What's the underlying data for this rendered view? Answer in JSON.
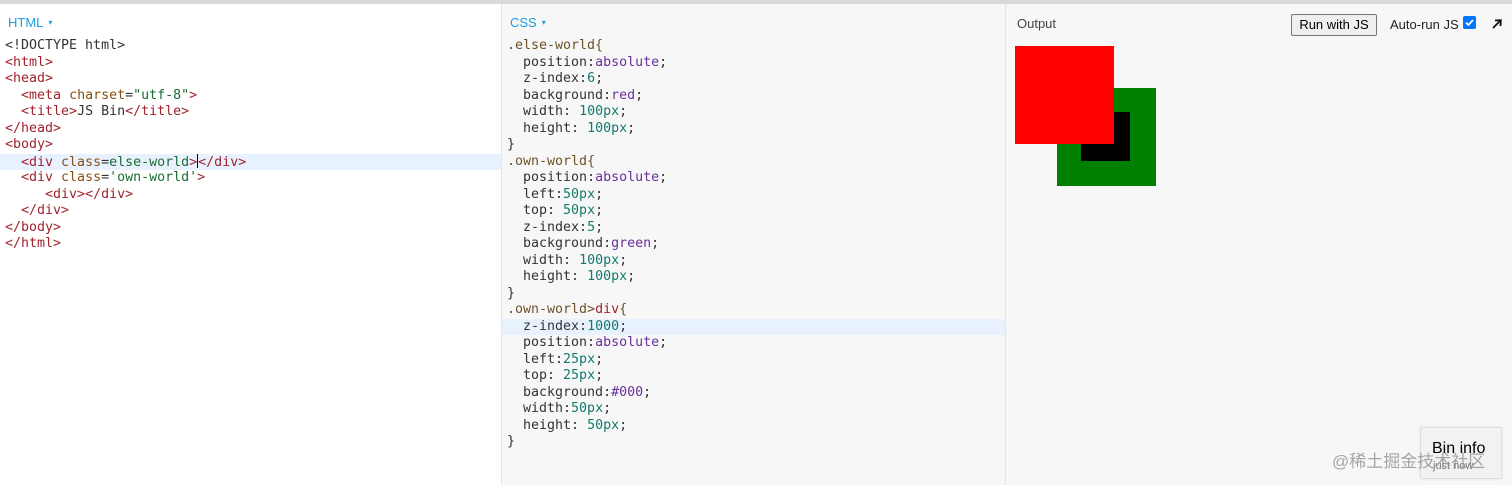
{
  "panes": {
    "html_title": "HTML",
    "css_title": "CSS",
    "output_title": "Output",
    "caret": "▾"
  },
  "html_code": [
    [
      [
        "t-plain",
        "<!DOCTYPE html>"
      ]
    ],
    [
      [
        "t-tag",
        "<html>"
      ]
    ],
    [
      [
        "t-tag",
        "<head>"
      ]
    ],
    [
      [
        "t-plain",
        "  "
      ],
      [
        "t-tag",
        "<meta "
      ],
      [
        "t-attr",
        "charset"
      ],
      [
        "t-plain",
        "="
      ],
      [
        "t-str",
        "\"utf-8\""
      ],
      [
        "t-tag",
        ">"
      ]
    ],
    [
      [
        "t-plain",
        "  "
      ],
      [
        "t-tag",
        "<title>"
      ],
      [
        "t-plain",
        "JS Bin"
      ],
      [
        "t-tag",
        "</title>"
      ]
    ],
    [
      [
        "t-tag",
        "</head>"
      ]
    ],
    [
      [
        "t-tag",
        "<body>"
      ]
    ],
    [
      [
        "t-plain",
        "  "
      ],
      [
        "t-tag",
        "<div "
      ],
      [
        "t-attr",
        "class"
      ],
      [
        "t-plain",
        "="
      ],
      [
        "t-str",
        "else-world"
      ],
      [
        "t-tag",
        ">"
      ],
      [
        "cursor",
        ""
      ],
      [
        "t-tag",
        "</div>"
      ]
    ],
    [
      [
        "t-plain",
        "  "
      ],
      [
        "t-tag",
        "<div "
      ],
      [
        "t-attr",
        "class"
      ],
      [
        "t-plain",
        "="
      ],
      [
        "t-str",
        "'own-world'"
      ],
      [
        "t-tag",
        ">"
      ]
    ],
    [
      [
        "t-plain",
        "     "
      ],
      [
        "t-tag",
        "<div></div>"
      ]
    ],
    [
      [
        "t-plain",
        "  "
      ],
      [
        "t-tag",
        "</div>"
      ]
    ],
    [
      [
        "t-tag",
        "</body>"
      ]
    ],
    [
      [
        "t-tag",
        "</html>"
      ]
    ]
  ],
  "html_active_line": 7,
  "css_code": [
    [
      [
        "t-sel",
        ".else-world{"
      ]
    ],
    [
      [
        "t-prop",
        "  position:"
      ],
      [
        "t-val",
        "absolute"
      ],
      [
        "t-plain",
        ";"
      ]
    ],
    [
      [
        "t-prop",
        "  z-index:"
      ],
      [
        "t-num",
        "6"
      ],
      [
        "t-plain",
        ";"
      ]
    ],
    [
      [
        "t-prop",
        "  background:"
      ],
      [
        "t-val",
        "red"
      ],
      [
        "t-plain",
        ";"
      ]
    ],
    [
      [
        "t-prop",
        "  width: "
      ],
      [
        "t-num",
        "100px"
      ],
      [
        "t-plain",
        ";"
      ]
    ],
    [
      [
        "t-prop",
        "  height: "
      ],
      [
        "t-num",
        "100px"
      ],
      [
        "t-plain",
        ";"
      ]
    ],
    [
      [
        "t-plain",
        "}"
      ]
    ],
    [
      [
        "t-sel",
        ".own-world{"
      ]
    ],
    [
      [
        "t-prop",
        "  position:"
      ],
      [
        "t-val",
        "absolute"
      ],
      [
        "t-plain",
        ";"
      ]
    ],
    [
      [
        "t-prop",
        "  left:"
      ],
      [
        "t-num",
        "50px"
      ],
      [
        "t-plain",
        ";"
      ]
    ],
    [
      [
        "t-prop",
        "  top: "
      ],
      [
        "t-num",
        "50px"
      ],
      [
        "t-plain",
        ";"
      ]
    ],
    [
      [
        "t-prop",
        "  z-index:"
      ],
      [
        "t-num",
        "5"
      ],
      [
        "t-plain",
        ";"
      ]
    ],
    [
      [
        "t-prop",
        "  background:"
      ],
      [
        "t-val",
        "green"
      ],
      [
        "t-plain",
        ";"
      ]
    ],
    [
      [
        "t-prop",
        "  width: "
      ],
      [
        "t-num",
        "100px"
      ],
      [
        "t-plain",
        ";"
      ]
    ],
    [
      [
        "t-prop",
        "  height: "
      ],
      [
        "t-num",
        "100px"
      ],
      [
        "t-plain",
        ";"
      ]
    ],
    [
      [
        "t-plain",
        "}"
      ]
    ],
    [
      [
        "t-sel",
        ".own-world>"
      ],
      [
        "t-tag",
        "div"
      ],
      [
        "t-sel",
        "{"
      ]
    ],
    [
      [
        "t-prop",
        "  z-index:"
      ],
      [
        "t-num",
        "1000"
      ],
      [
        "t-plain",
        ";"
      ]
    ],
    [
      [
        "t-prop",
        "  position:"
      ],
      [
        "t-val",
        "absolute"
      ],
      [
        "t-plain",
        ";"
      ]
    ],
    [
      [
        "t-prop",
        "  left:"
      ],
      [
        "t-num",
        "25px"
      ],
      [
        "t-plain",
        ";"
      ]
    ],
    [
      [
        "t-prop",
        "  top: "
      ],
      [
        "t-num",
        "25px"
      ],
      [
        "t-plain",
        ";"
      ]
    ],
    [
      [
        "t-prop",
        "  background:"
      ],
      [
        "t-val",
        "#000"
      ],
      [
        "t-plain",
        ";"
      ]
    ],
    [
      [
        "t-prop",
        "  width:"
      ],
      [
        "t-num",
        "50px"
      ],
      [
        "t-plain",
        ";"
      ]
    ],
    [
      [
        "t-prop",
        "  height: "
      ],
      [
        "t-num",
        "50px"
      ],
      [
        "t-plain",
        ";"
      ]
    ],
    [
      [
        "t-plain",
        "}"
      ]
    ]
  ],
  "css_active_line": 17,
  "output": {
    "run_button": "Run with JS",
    "autorun_label": "Auto-run JS",
    "autorun_checked": true,
    "popout_icon": "arrow-up-right-icon",
    "boxes": {
      "red": "#ff0000",
      "green": "#008000",
      "black": "#000000"
    }
  },
  "bin_info": {
    "title": "Bin info",
    "subtitle": "just now"
  },
  "watermark": "@稀土掘金技术社区",
  "colors": {
    "accent": "#1a9fe0",
    "checkbox": "#0075ff",
    "active_line": "#e8f2ff"
  }
}
